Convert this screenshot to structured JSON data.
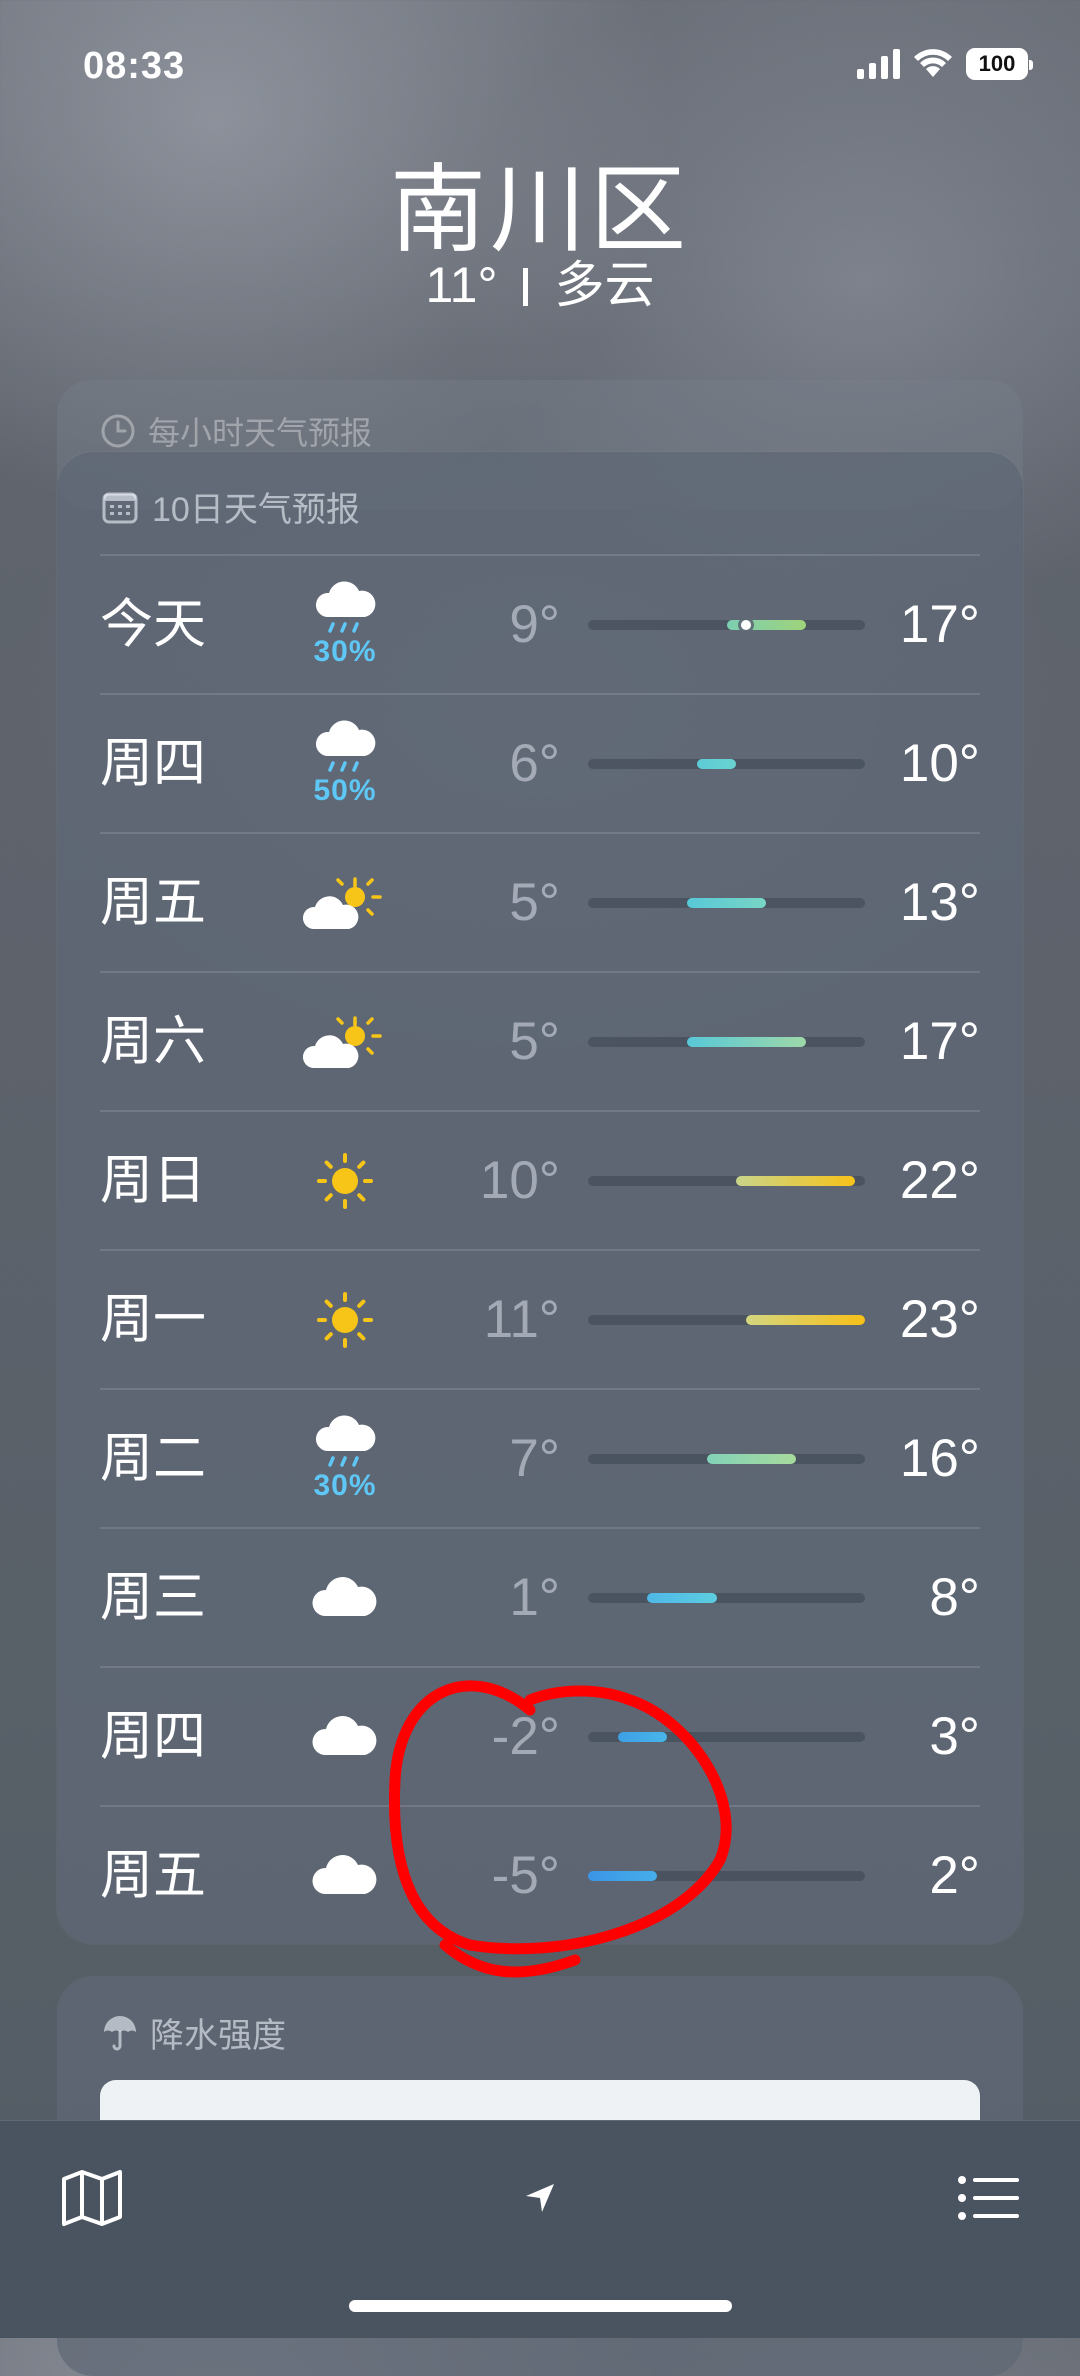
{
  "status_bar": {
    "time": "08:33",
    "battery": "100"
  },
  "location": {
    "city": "南川区",
    "current_temp": "11°",
    "condition": "多云"
  },
  "hourly_card": {
    "title": "每小时天气预报"
  },
  "forecast": {
    "title": "10日天气预报",
    "bar_range": {
      "min": -5,
      "max": 23
    },
    "days": [
      {
        "day": "今天",
        "icon": "cloud-rain-icon",
        "precip": "30%",
        "low": "9°",
        "high": "17°",
        "low_val": 9,
        "high_val": 17,
        "current_val": 11,
        "colors": [
          "#7ccfb2",
          "#9ed37a"
        ]
      },
      {
        "day": "周四",
        "icon": "cloud-rain-icon",
        "precip": "50%",
        "low": "6°",
        "high": "10°",
        "low_val": 6,
        "high_val": 10,
        "colors": [
          "#5ccbd6",
          "#6ad3d0"
        ]
      },
      {
        "day": "周五",
        "icon": "partly-sunny-icon",
        "precip": "",
        "low": "5°",
        "high": "13°",
        "low_val": 5,
        "high_val": 13,
        "colors": [
          "#58c8d8",
          "#78d6c4"
        ]
      },
      {
        "day": "周六",
        "icon": "partly-sunny-icon",
        "precip": "",
        "low": "5°",
        "high": "17°",
        "low_val": 5,
        "high_val": 17,
        "colors": [
          "#58c8d8",
          "#9ed8a8"
        ]
      },
      {
        "day": "周日",
        "icon": "sun-icon",
        "precip": "",
        "low": "10°",
        "high": "22°",
        "low_val": 10,
        "high_val": 22,
        "colors": [
          "#c9d58a",
          "#f7c21a"
        ]
      },
      {
        "day": "周一",
        "icon": "sun-icon",
        "precip": "",
        "low": "11°",
        "high": "23°",
        "low_val": 11,
        "high_val": 23,
        "colors": [
          "#d3d680",
          "#f8c018"
        ]
      },
      {
        "day": "周二",
        "icon": "cloud-rain-icon",
        "precip": "30%",
        "low": "7°",
        "high": "16°",
        "low_val": 7,
        "high_val": 16,
        "colors": [
          "#82d2b8",
          "#a8da9c"
        ]
      },
      {
        "day": "周三",
        "icon": "cloud-icon",
        "precip": "",
        "low": "1°",
        "high": "8°",
        "low_val": 1,
        "high_val": 8,
        "colors": [
          "#4fb8e8",
          "#5ccde0"
        ]
      },
      {
        "day": "周四",
        "icon": "cloud-icon",
        "precip": "",
        "low": "-2°",
        "high": "3°",
        "low_val": -2,
        "high_val": 3,
        "colors": [
          "#3e9fe6",
          "#48b6ea"
        ]
      },
      {
        "day": "周五",
        "icon": "cloud-icon",
        "precip": "",
        "low": "-5°",
        "high": "2°",
        "low_val": -5,
        "high_val": 2,
        "colors": [
          "#3b95e6",
          "#45aeea"
        ]
      }
    ]
  },
  "precip_card": {
    "title": "降水强度"
  },
  "annotation_color": "#ff0000"
}
